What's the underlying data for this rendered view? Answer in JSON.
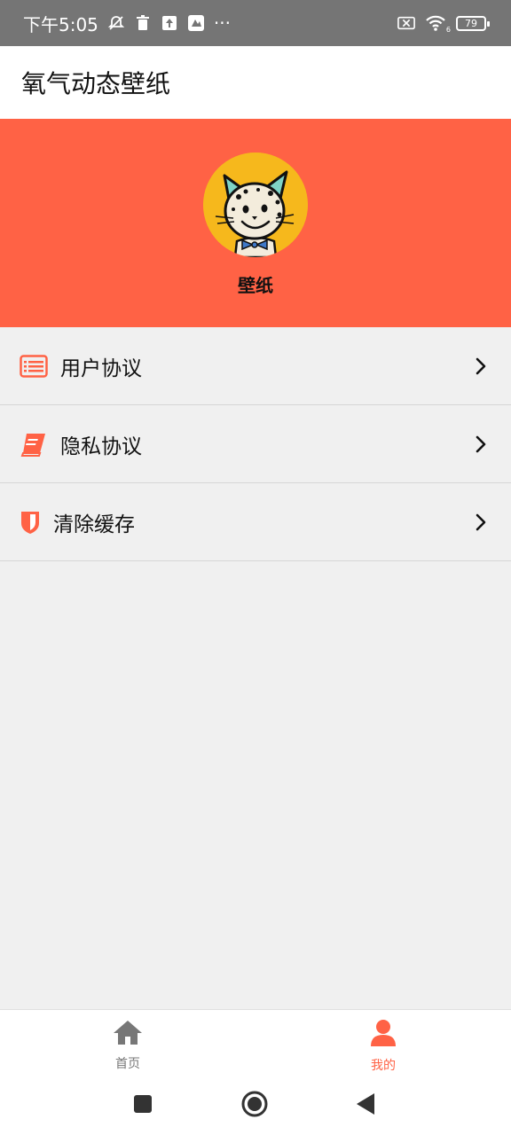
{
  "status_bar": {
    "time": "下午5:05",
    "more": "···",
    "battery": "79",
    "wifi_badge": "6"
  },
  "header": {
    "title": "氧气动态壁纸"
  },
  "profile": {
    "name": "壁纸"
  },
  "menu": {
    "items": [
      {
        "label": "用户协议",
        "icon": "list-icon"
      },
      {
        "label": "隐私协议",
        "icon": "book-icon"
      },
      {
        "label": "清除缓存",
        "icon": "shield-icon"
      }
    ]
  },
  "bottom_nav": {
    "items": [
      {
        "label": "首页",
        "icon": "home-icon",
        "active": false
      },
      {
        "label": "我的",
        "icon": "person-icon",
        "active": true
      }
    ]
  },
  "colors": {
    "accent": "#ff6245",
    "status_bar": "#757575",
    "avatar_bg": "#f6b81c",
    "inactive": "#777777"
  }
}
